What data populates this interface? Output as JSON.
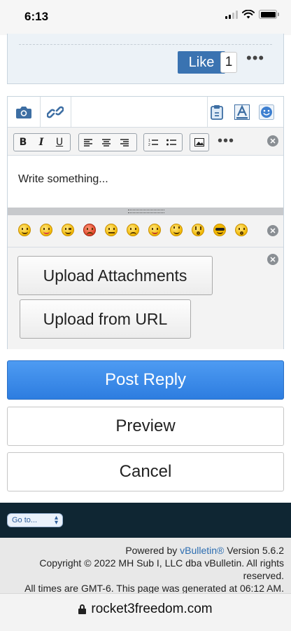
{
  "status_bar": {
    "time": "6:13"
  },
  "post": {
    "like_label": "Like",
    "like_count": "1",
    "more": "•••"
  },
  "editor": {
    "toolbar": {
      "icons": [
        "camera-icon",
        "link-icon",
        "paste-icon",
        "font-color-icon",
        "smilie-icon"
      ]
    },
    "format": {
      "bold": "B",
      "italic": "I",
      "underline": "U",
      "more": "•••"
    },
    "placeholder": "Write something...",
    "smilies": [
      "smile",
      "tongue",
      "wink",
      "mad",
      "confused",
      "frown",
      "redface",
      "rolleyes",
      "eek",
      "cool",
      "surprised"
    ],
    "upload_attachments": "Upload Attachments",
    "upload_from_url": "Upload from URL"
  },
  "actions": {
    "post_reply": "Post Reply",
    "preview": "Preview",
    "cancel": "Cancel"
  },
  "footer": {
    "goto_label": "Go to...",
    "powered_prefix": "Powered by",
    "powered_link": "vBulletin®",
    "powered_version": "Version 5.6.2",
    "copyright_1": "Copyright © 2022 MH Sub I, LLC dba vBulletin. All rights",
    "copyright_2": "reserved.",
    "times": "All times are GMT-6. This page was generated at 06:12 AM."
  },
  "browser": {
    "url": "rocket3freedom.com"
  },
  "colors": {
    "like_button": "#3a73b1",
    "post_reply": "#2d7de0",
    "footer_dark": "#0f2633",
    "link": "#2b6cb0"
  }
}
